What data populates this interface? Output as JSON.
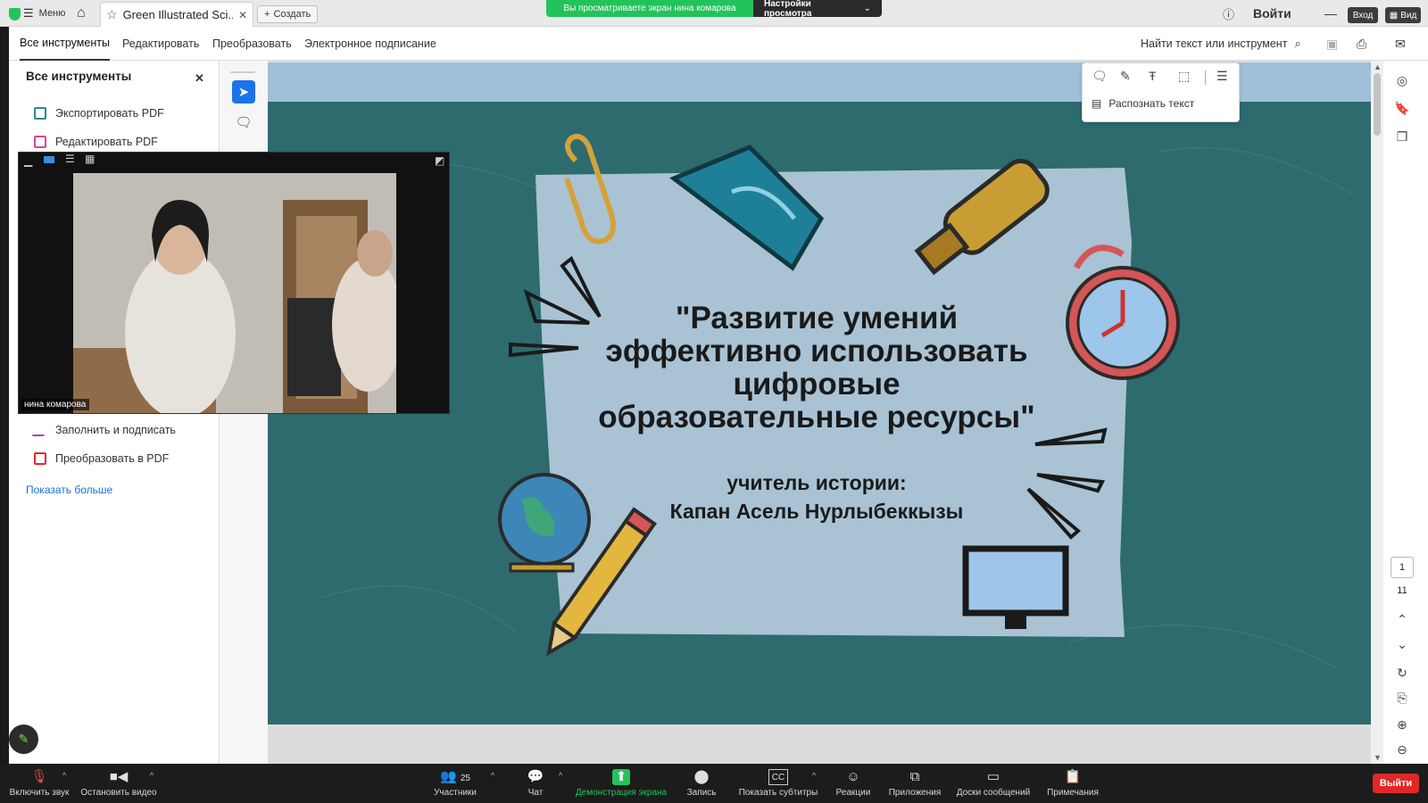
{
  "tabbar": {
    "menu_label": "Меню",
    "tab_title": "Green Illustrated Sci...",
    "new_label": "Создать",
    "signin": "Войти",
    "btn_login": "Вход",
    "btn_view": "Вид"
  },
  "share_banner": {
    "viewing": "Вы просматриваете экран нина комарова",
    "settings": "Настройки просмотра"
  },
  "menubar": {
    "items": [
      "Все инструменты",
      "Редактировать",
      "Преобразовать",
      "Электронное подписание"
    ],
    "search": "Найти текст или инструмент"
  },
  "leftpanel": {
    "title": "Все инструменты",
    "items": [
      {
        "label": "Экспортировать PDF",
        "color": "#2a8c87"
      },
      {
        "label": "Редактировать PDF",
        "color": "#d9478f"
      },
      {
        "label": "Заполнить и подписать",
        "color": "#8b4ac9"
      },
      {
        "label": "Преобразовать в PDF",
        "color": "#e02a2a"
      }
    ],
    "more": "Показать больше"
  },
  "floattb": {
    "ocr": "Распознать текст"
  },
  "slide": {
    "title": [
      "\"Развитие умений",
      "эффективно использовать",
      "цифровые",
      "образовательные ресурсы\""
    ],
    "role": "учитель истории:",
    "name": "Капан Асель Нурлыбеккызы",
    "bg": "#2d6b6e",
    "paper": "#a9c3d4"
  },
  "video": {
    "name": "нина комарова"
  },
  "pages": {
    "current": "1",
    "total": "11"
  },
  "bottombar": {
    "items": [
      {
        "label": "Включить звук",
        "icon": "mic-muted-icon"
      },
      {
        "label": "Остановить видео",
        "icon": "camera-icon"
      },
      {
        "label": "Участники",
        "icon": "participants-icon",
        "count": "25"
      },
      {
        "label": "Чат",
        "icon": "chat-icon"
      },
      {
        "label": "Демонстрация экрана",
        "icon": "share-screen-icon"
      },
      {
        "label": "Запись",
        "icon": "record-icon"
      },
      {
        "label": "Показать субтитры",
        "icon": "captions-icon"
      },
      {
        "label": "Реакции",
        "icon": "reactions-icon"
      },
      {
        "label": "Приложения",
        "icon": "apps-icon"
      },
      {
        "label": "Доски сообщений",
        "icon": "whiteboard-icon"
      },
      {
        "label": "Примечания",
        "icon": "notes-icon"
      }
    ],
    "leave": "Выйти"
  }
}
